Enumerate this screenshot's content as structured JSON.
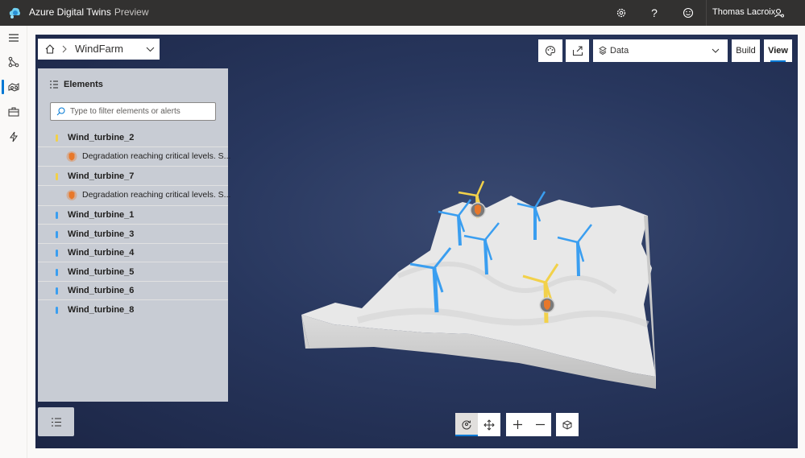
{
  "header": {
    "app_title": "Azure Digital Twins",
    "app_badge": "Preview",
    "user_name": "Thomas Lacroix",
    "icons": [
      "settings-icon",
      "help-icon",
      "feedback-icon",
      "account-icon"
    ]
  },
  "leftnav": {
    "items": [
      {
        "name": "menu",
        "icon": "hamburger-icon"
      },
      {
        "name": "graph",
        "icon": "graph-icon"
      },
      {
        "name": "3d-scenes",
        "icon": "scenes-icon",
        "active": true
      },
      {
        "name": "toolbox",
        "icon": "toolbox-icon"
      },
      {
        "name": "events",
        "icon": "lightning-icon"
      }
    ]
  },
  "breadcrumb": {
    "scene_name": "WindFarm"
  },
  "elements_panel": {
    "title": "Elements",
    "filter_placeholder": "Type to filter elements or alerts",
    "items": [
      {
        "label": "Wind_turbine_2",
        "status": "warning",
        "alert": "Degradation reaching critical levels. S..."
      },
      {
        "label": "Wind_turbine_7",
        "status": "warning",
        "alert": "Degradation reaching critical levels. S..."
      },
      {
        "label": "Wind_turbine_1",
        "status": "ok"
      },
      {
        "label": "Wind_turbine_3",
        "status": "ok"
      },
      {
        "label": "Wind_turbine_4",
        "status": "ok"
      },
      {
        "label": "Wind_turbine_5",
        "status": "ok"
      },
      {
        "label": "Wind_turbine_6",
        "status": "ok"
      },
      {
        "label": "Wind_turbine_8",
        "status": "ok"
      }
    ]
  },
  "toolbar": {
    "layer_dropdown": "Data",
    "build_label": "Build",
    "view_label": "View",
    "active_mode": "View"
  },
  "colors": {
    "accent": "#0078d4",
    "warning": "#f2d14a",
    "ok": "#3a9ef0",
    "alert": "#e8782a"
  }
}
